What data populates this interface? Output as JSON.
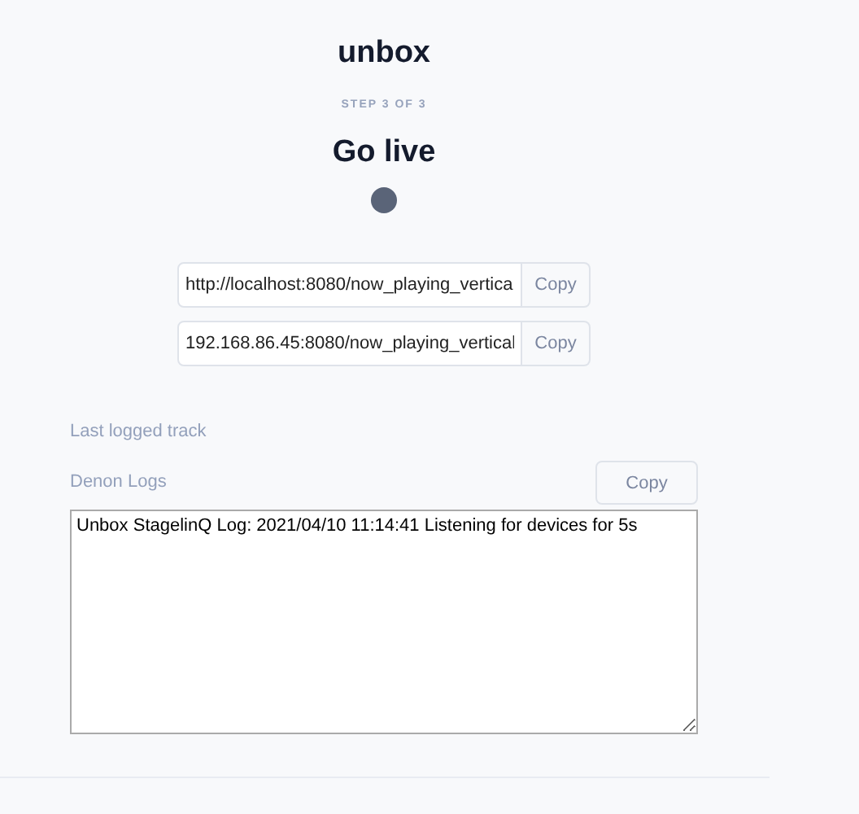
{
  "app_title": "unbox",
  "step": "STEP 3 OF 3",
  "heading": "Go live",
  "urls": [
    {
      "value": "http://localhost:8080/now_playing_vertica",
      "button": "Copy"
    },
    {
      "value": "192.168.86.45:8080/now_playing_vertical",
      "button": "Copy"
    }
  ],
  "last_track_label": "Last logged track",
  "logs": {
    "label": "Denon Logs",
    "button": "Copy",
    "text": "Unbox StagelinQ Log: 2021/04/10 11:14:41 Listening for devices for 5s"
  }
}
